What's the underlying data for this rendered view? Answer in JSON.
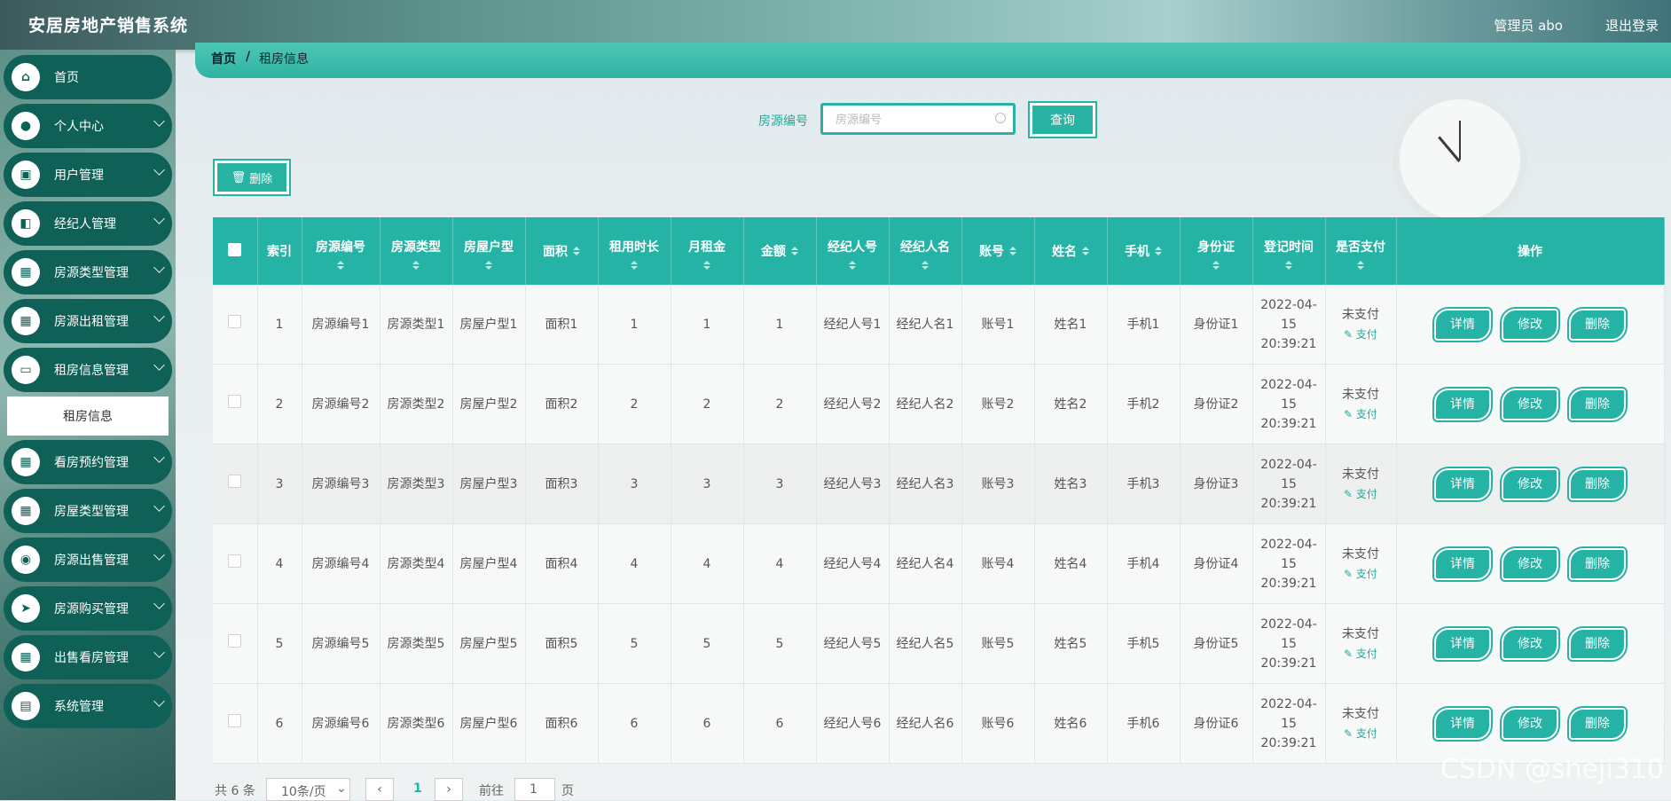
{
  "header": {
    "title": "安居房地产销售系统",
    "admin_label": "管理员 abo",
    "logout_label": "退出登录"
  },
  "sidebar": {
    "items": [
      {
        "label": "首页",
        "icon": "home-icon",
        "glyph": "⌂"
      },
      {
        "label": "个人中心",
        "icon": "user-icon",
        "glyph": "●"
      },
      {
        "label": "用户管理",
        "icon": "briefcase-icon",
        "glyph": "▣"
      },
      {
        "label": "经纪人管理",
        "icon": "wallet-icon",
        "glyph": "◧"
      },
      {
        "label": "房源类型管理",
        "icon": "grid-icon",
        "glyph": "▦"
      },
      {
        "label": "房源出租管理",
        "icon": "grid-icon",
        "glyph": "▦"
      },
      {
        "label": "租房信息管理",
        "icon": "monitor-icon",
        "glyph": "▭"
      },
      {
        "label": "看房预约管理",
        "icon": "grid-icon",
        "glyph": "▦"
      },
      {
        "label": "房屋类型管理",
        "icon": "grid-icon",
        "glyph": "▦"
      },
      {
        "label": "房源出售管理",
        "icon": "location-icon",
        "glyph": "◉"
      },
      {
        "label": "房源购买管理",
        "icon": "send-icon",
        "glyph": "➤"
      },
      {
        "label": "出售看房管理",
        "icon": "grid-icon",
        "glyph": "▦"
      },
      {
        "label": "系统管理",
        "icon": "clipboard-icon",
        "glyph": "▤"
      }
    ],
    "sub_item": "租房信息"
  },
  "breadcrumb": {
    "home": "首页",
    "sep": "/",
    "current": "租房信息"
  },
  "search": {
    "label": "房源编号",
    "placeholder": "房源编号",
    "query_label": "查询"
  },
  "toolbar": {
    "delete_label": "删除"
  },
  "table": {
    "headers": [
      "索引",
      "房源编号",
      "房源类型",
      "房屋户型",
      "面积",
      "租用时长",
      "月租金",
      "金额",
      "经纪人号",
      "经纪人名",
      "账号",
      "姓名",
      "手机",
      "身份证",
      "登记时间",
      "是否支付",
      "操作"
    ],
    "rows": [
      [
        "1",
        "房源编号1",
        "房源类型1",
        "房屋户型1",
        "面积1",
        "1",
        "1",
        "1",
        "经纪人号1",
        "经纪人名1",
        "账号1",
        "姓名1",
        "手机1",
        "身份证1",
        "2022-04-15 20:39:21",
        "未支付"
      ],
      [
        "2",
        "房源编号2",
        "房源类型2",
        "房屋户型2",
        "面积2",
        "2",
        "2",
        "2",
        "经纪人号2",
        "经纪人名2",
        "账号2",
        "姓名2",
        "手机2",
        "身份证2",
        "2022-04-15 20:39:21",
        "未支付"
      ],
      [
        "3",
        "房源编号3",
        "房源类型3",
        "房屋户型3",
        "面积3",
        "3",
        "3",
        "3",
        "经纪人号3",
        "经纪人名3",
        "账号3",
        "姓名3",
        "手机3",
        "身份证3",
        "2022-04-15 20:39:21",
        "未支付"
      ],
      [
        "4",
        "房源编号4",
        "房源类型4",
        "房屋户型4",
        "面积4",
        "4",
        "4",
        "4",
        "经纪人号4",
        "经纪人名4",
        "账号4",
        "姓名4",
        "手机4",
        "身份证4",
        "2022-04-15 20:39:21",
        "未支付"
      ],
      [
        "5",
        "房源编号5",
        "房源类型5",
        "房屋户型5",
        "面积5",
        "5",
        "5",
        "5",
        "经纪人号5",
        "经纪人名5",
        "账号5",
        "姓名5",
        "手机5",
        "身份证5",
        "2022-04-15 20:39:21",
        "未支付"
      ],
      [
        "6",
        "房源编号6",
        "房源类型6",
        "房屋户型6",
        "面积6",
        "6",
        "6",
        "6",
        "经纪人号6",
        "经纪人名6",
        "账号6",
        "姓名6",
        "手机6",
        "身份证6",
        "2022-04-15 20:39:21",
        "未支付"
      ]
    ],
    "pay_link": "支付",
    "actions": [
      "详情",
      "修改",
      "删除"
    ]
  },
  "pagination": {
    "total": "共 6 条",
    "page_size": "10条/页",
    "current_page": "1",
    "goto_label": "前往",
    "goto_value": "1",
    "page_suffix": "页"
  },
  "watermark": "CSDN @sheji310",
  "colors": {
    "primary": "#25b3a5",
    "sidebar": "#0f6158"
  }
}
